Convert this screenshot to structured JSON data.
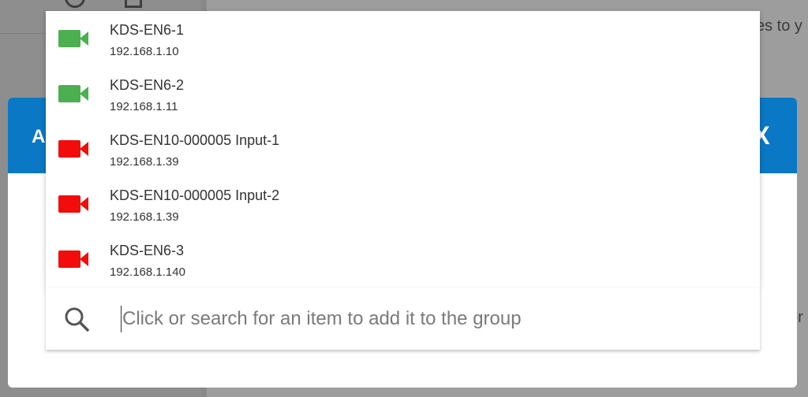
{
  "background": {
    "right_text_top": "es to y",
    "right_text_bottom": "or"
  },
  "modal": {
    "title_fragment": "A",
    "close_glyph": "X",
    "header_color": "#0a78c4"
  },
  "devices": [
    {
      "name": "KDS-EN6-1",
      "ip": "192.168.1.10",
      "status_color": "#4caf50",
      "icon": "camera-icon"
    },
    {
      "name": "KDS-EN6-2",
      "ip": "192.168.1.11",
      "status_color": "#4caf50",
      "icon": "camera-icon"
    },
    {
      "name": "KDS-EN10-000005 Input-1",
      "ip": "192.168.1.39",
      "status_color": "#f20c0c",
      "icon": "camera-icon"
    },
    {
      "name": "KDS-EN10-000005 Input-2",
      "ip": "192.168.1.39",
      "status_color": "#f20c0c",
      "icon": "camera-icon"
    },
    {
      "name": "KDS-EN6-3",
      "ip": "192.168.1.140",
      "status_color": "#f20c0c",
      "icon": "camera-icon"
    }
  ],
  "search": {
    "placeholder": "Click or search for an item to add it to the group",
    "value": "",
    "icon": "search-icon"
  }
}
